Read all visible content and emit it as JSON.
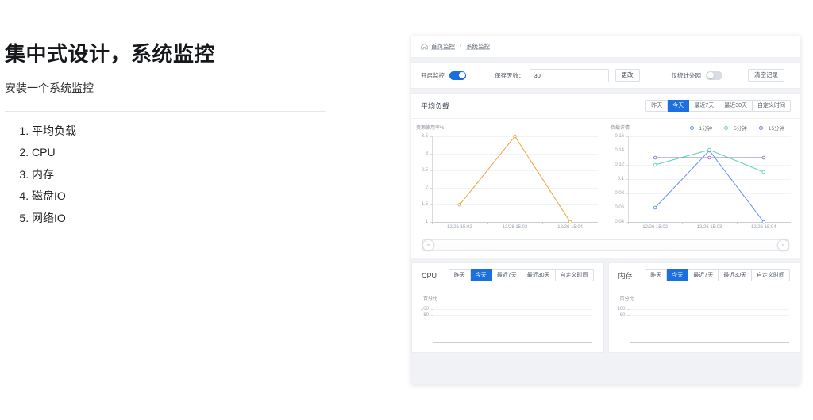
{
  "doc": {
    "title": "集中式设计，系统监控",
    "subtitle": "安装一个系统监控",
    "list": [
      "平均负载",
      "CPU",
      "内存",
      "磁盘IO",
      "网络IO"
    ]
  },
  "app": {
    "breadcrumb": {
      "home_icon": "home-icon",
      "items": [
        "首页监控",
        "系统监控"
      ],
      "separator": "/"
    },
    "toolbar": {
      "monitor_label": "开启监控",
      "monitor_on": true,
      "days_label": "保存天数：",
      "days_value": "30",
      "days_placeholder": "30",
      "change_label": "更改",
      "wan_label": "仅统计外网",
      "wan_on": false,
      "clear_label": "清空记录"
    },
    "range_options": [
      "昨天",
      "今天",
      "最近7天",
      "最近30天",
      "自定义时间"
    ],
    "range_selected": "今天",
    "load_card": {
      "title": "平均负载",
      "legend": [
        {
          "label": "1分钟",
          "color": "#5b8ff9"
        },
        {
          "label": "5分钟",
          "color": "#5ad8a6"
        },
        {
          "label": "15分钟",
          "color": "#9270ca"
        }
      ]
    },
    "cpu_card": {
      "title": "CPU"
    },
    "mem_card": {
      "title": "内存"
    },
    "colors": {
      "accent": "#1c6fe0",
      "panel_bg": "#f1f2f5",
      "card_bg": "#ffffff",
      "border": "#ebedf0",
      "orange": "#e8a33d"
    }
  },
  "chart_data": [
    {
      "type": "line",
      "name": "资源使用率",
      "title": "",
      "ylabel": "资源使用率%",
      "xlabel": "",
      "categories": [
        "12/26 15:02",
        "12/26 15:03",
        "12/26 15:04"
      ],
      "yticks": [
        1,
        1.5,
        2,
        2.5,
        3,
        3.5
      ],
      "ylim": [
        1,
        3.5
      ],
      "grid": true,
      "legend_position": "none",
      "series": [
        {
          "name": "资源使用率",
          "color": "#e8a33d",
          "values": [
            1.5,
            3.5,
            1.0
          ]
        }
      ]
    },
    {
      "type": "line",
      "name": "负载详情",
      "title": "",
      "ylabel": "负载详情",
      "xlabel": "",
      "categories": [
        "12/26 15:02",
        "12/26 15:03",
        "12/26 15:04"
      ],
      "yticks": [
        0.04,
        0.06,
        0.08,
        0.1,
        0.12,
        0.14,
        0.16
      ],
      "ylim": [
        0.04,
        0.16
      ],
      "grid": true,
      "legend_position": "top-right",
      "series": [
        {
          "name": "1分钟",
          "color": "#5b8ff9",
          "values": [
            0.06,
            0.14,
            0.04
          ]
        },
        {
          "name": "5分钟",
          "color": "#5ad8a6",
          "values": [
            0.12,
            0.141,
            0.11
          ]
        },
        {
          "name": "15分钟",
          "color": "#9270ca",
          "values": [
            0.13,
            0.13,
            0.13
          ]
        }
      ]
    },
    {
      "type": "line",
      "name": "CPU",
      "title": "CPU",
      "ylabel": "百分比",
      "xlabel": "",
      "categories": [],
      "yticks": [
        80,
        100
      ],
      "ylim": [
        0,
        100
      ],
      "grid": true,
      "legend_position": "none",
      "series": []
    },
    {
      "type": "line",
      "name": "内存",
      "title": "内存",
      "ylabel": "百分比",
      "xlabel": "",
      "categories": [],
      "yticks": [
        80,
        100
      ],
      "ylim": [
        0,
        100
      ],
      "grid": true,
      "legend_position": "none",
      "series": []
    }
  ]
}
